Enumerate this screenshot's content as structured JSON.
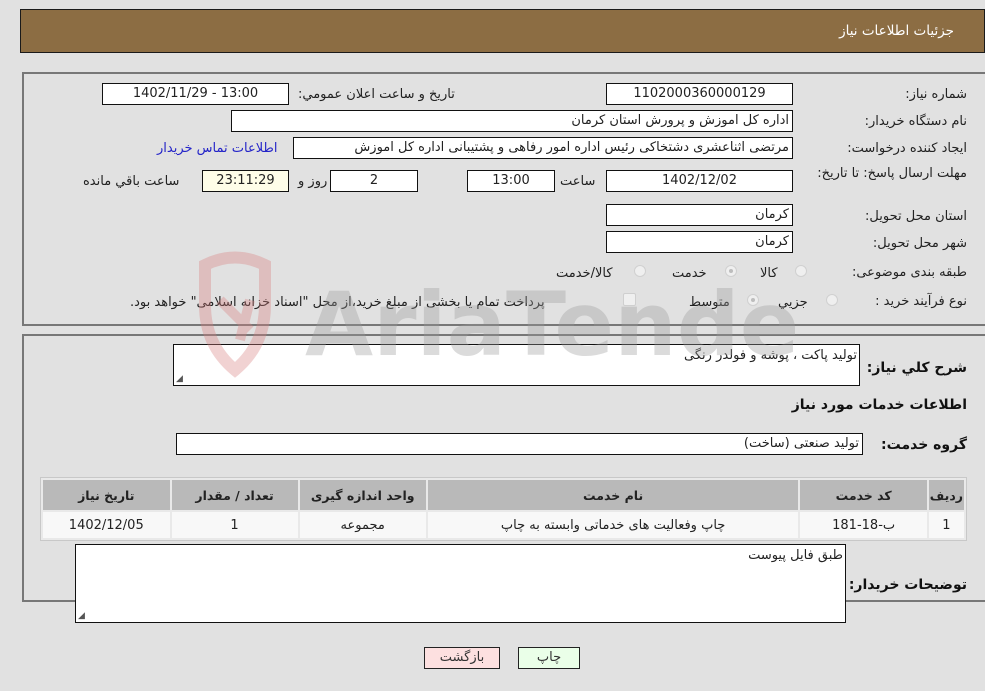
{
  "header": {
    "title": "جزئیات اطلاعات نیاز"
  },
  "form": {
    "need_number": {
      "label": "شماره نیاز:",
      "value": "1102000360000129"
    },
    "announce_datetime": {
      "label": "تاريخ و ساعت اعلان عمومي:",
      "value": "1402/11/29 - 13:00"
    },
    "buyer_org": {
      "label": "نام دستگاه خريدار:",
      "value": "اداره کل اموزش و پرورش استان کرمان"
    },
    "requester": {
      "label": "ایجاد کننده درخواست:",
      "value": "مرتضی اثناعشری دشتخاکی رئیس اداره امور رفاهی و پشتیبانی اداره کل اموزش"
    },
    "buyer_contact_link": "اطلاعات تماس خریدار",
    "deadline": {
      "label": "مهلت ارسال پاسخ: تا تاریخ:",
      "date": "1402/12/02",
      "time_label": "ساعت",
      "time": "13:00",
      "days": "2",
      "days_label": "روز و",
      "remaining": "23:11:29",
      "remaining_label": "ساعت باقي مانده"
    },
    "delivery_province": {
      "label": "استان محل تحویل:",
      "value": "کرمان"
    },
    "delivery_city": {
      "label": "شهر محل تحویل:",
      "value": "کرمان"
    },
    "category": {
      "label": "طبقه بندی موضوعی:",
      "options": [
        "کالا",
        "خدمت",
        "کالا/خدمت"
      ],
      "selected": "خدمت"
    },
    "purchase_type": {
      "label": "نوع فرآیند خرید :",
      "options": [
        "جزیي",
        "متوسط"
      ],
      "selected": "متوسط",
      "treasury_checkbox_label": "پرداخت تمام یا بخشی از مبلغ خرید،از محل \"اسناد خزانه اسلامی\" خواهد بود.",
      "treasury_checked": false
    }
  },
  "details": {
    "description_label": "شرح کلي نياز:",
    "description_value": "تولید پاکت ، پوشه و فولدر رنگی",
    "services_heading": "اطلاعات خدمات مورد نياز",
    "service_group_label": "گروه خدمت:",
    "service_group_value": "تولید صنعتی (ساخت)",
    "table": {
      "headers": [
        "رديف",
        "کد خدمت",
        "نام خدمت",
        "واحد اندازه گیری",
        "تعداد / مقدار",
        "تاریخ نیاز"
      ],
      "rows": [
        [
          "1",
          "ب-18-181",
          "چاپ وفعالیت های خدماتی وابسته به چاپ",
          "مجموعه",
          "1",
          "1402/12/05"
        ]
      ]
    },
    "buyer_notes_label": "توضیحات خریدار:",
    "buyer_notes_value": "طبق فایل پیوست"
  },
  "buttons": {
    "print": "چاپ",
    "back": "بازگشت"
  },
  "watermark": {
    "text": "AriaTender.neT"
  }
}
